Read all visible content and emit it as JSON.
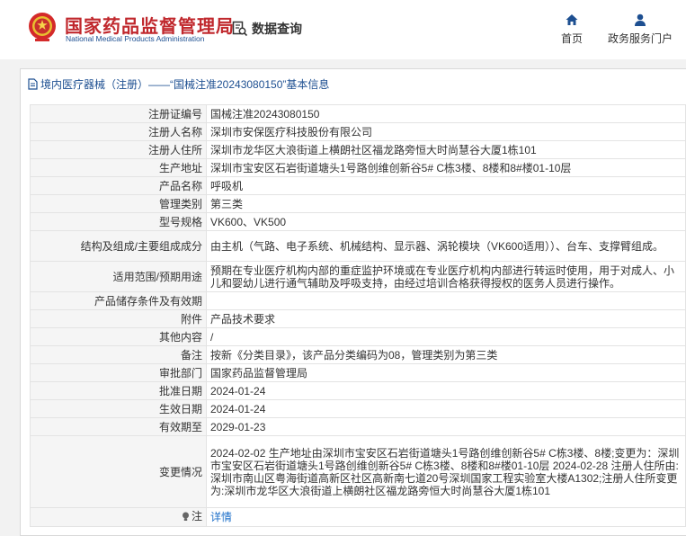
{
  "header": {
    "brand_cn": "国家药品监督管理局",
    "brand_en": "National Medical Products Administration",
    "data_query": "数据查询",
    "nav": [
      {
        "label": "首页",
        "icon": "home-icon"
      },
      {
        "label": "政务服务门户",
        "icon": "user-icon"
      }
    ]
  },
  "breadcrumb": {
    "text": "境内医疗器械（注册）——“国械注准20243080150”基本信息",
    "icon": "document-icon"
  },
  "colors": {
    "brand_red": "#c0282d",
    "brand_blue": "#1d4f91",
    "link_blue": "#1d6fc9",
    "band_gray": "#f2f2f2",
    "label_bg": "#f5f5f5"
  },
  "rows": [
    {
      "label": "注册证编号",
      "value": "国械注准20243080150"
    },
    {
      "label": "注册人名称",
      "value": "深圳市安保医疗科技股份有限公司"
    },
    {
      "label": "注册人住所",
      "value": "深圳市龙华区大浪街道上横朗社区福龙路旁恒大时尚慧谷大厦1栋101"
    },
    {
      "label": "生产地址",
      "value": "深圳市宝安区石岩街道塘头1号路创维创新谷5# C栋3楼、8楼和8#楼01-10层"
    },
    {
      "label": "产品名称",
      "value": "呼吸机"
    },
    {
      "label": "管理类别",
      "value": "第三类"
    },
    {
      "label": "型号规格",
      "value": "VK600、VK500"
    },
    {
      "label": "结构及组成/主要组成成分",
      "value": "由主机（气路、电子系统、机械结构、显示器、涡轮模块（VK600适用））、台车、支撑臂组成。"
    },
    {
      "label": "适用范围/预期用途",
      "value": "预期在专业医疗机构内部的重症监护环境或在专业医疗机构内部进行转运时使用，用于对成人、小儿和婴幼儿进行通气辅助及呼吸支持，由经过培训合格获得授权的医务人员进行操作。"
    },
    {
      "label": "产品储存条件及有效期",
      "value": ""
    },
    {
      "label": "附件",
      "value": "产品技术要求"
    },
    {
      "label": "其他内容",
      "value": "/"
    },
    {
      "label": "备注",
      "value": "按新《分类目录》，该产品分类编码为08，管理类别为第三类"
    },
    {
      "label": "审批部门",
      "value": "国家药品监督管理局"
    },
    {
      "label": "批准日期",
      "value": "2024-01-24"
    },
    {
      "label": "生效日期",
      "value": "2024-01-24"
    },
    {
      "label": "有效期至",
      "value": "2029-01-23"
    },
    {
      "label": "变更情况",
      "value": "2024-02-02 生产地址由深圳市宝安区石岩街道塘头1号路创维创新谷5# C栋3楼、8楼;变更为：深圳市宝安区石岩街道塘头1号路创维创新谷5# C栋3楼、8楼和8#楼01-10层 2024-02-28 注册人住所由:深圳市南山区粤海街道高新区社区高新南七道20号深圳国家工程实验室大楼A1302;注册人住所变更为:深圳市龙华区大浪街道上横朗社区福龙路旁恒大时尚慧谷大厦1栋101"
    },
    {
      "label": "注",
      "value": "详情",
      "icon": "bulb-icon"
    }
  ]
}
